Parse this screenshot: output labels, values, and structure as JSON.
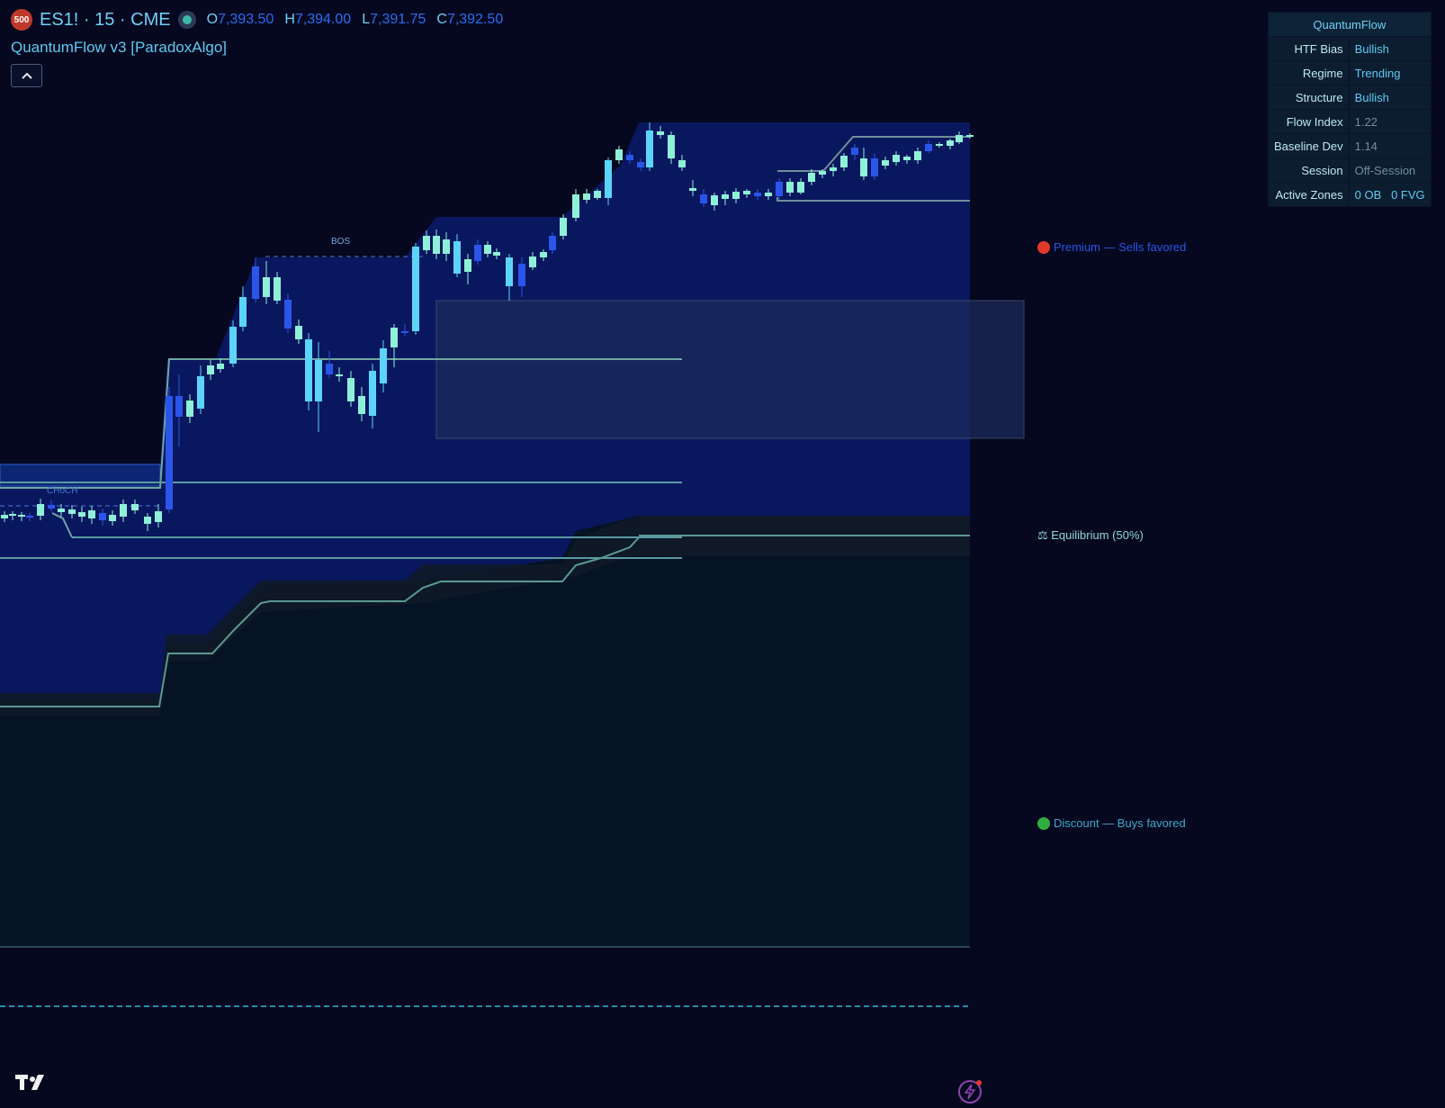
{
  "header": {
    "badge": "500",
    "symbol": "ES1! · 15 · CME",
    "ohlc": [
      {
        "key": "O",
        "value": "7,393.50"
      },
      {
        "key": "H",
        "value": "7,394.00"
      },
      {
        "key": "L",
        "value": "7,391.75"
      },
      {
        "key": "C",
        "value": "7,392.50"
      }
    ]
  },
  "indicator": {
    "title": "QuantumFlow v3 [ParadoxAlgo]"
  },
  "panel": {
    "title": "QuantumFlow",
    "rows": [
      {
        "label": "HTF Bias",
        "value": "Bullish",
        "color": "#5ecbf2"
      },
      {
        "label": "Regime",
        "value": "Trending",
        "color": "#5ecbf2"
      },
      {
        "label": "Structure",
        "value": "Bullish",
        "color": "#5ecbf2"
      },
      {
        "label": "Flow Index",
        "value": "1.22",
        "color": "#6f8fa0"
      },
      {
        "label": "Baseline Dev",
        "value": "1.14",
        "color": "#6f8fa0"
      },
      {
        "label": "Session",
        "value": "Off-Session",
        "color": "#6f8fa0"
      },
      {
        "label": "Active Zones",
        "value": "0 OB   0 FVG",
        "color": "#5ecbf2"
      }
    ]
  },
  "zones": {
    "premium": "Premium — Sells favored",
    "equilibrium": "⚖ Equilibrium (50%)",
    "discount": "Discount — Buys favored"
  },
  "annotations": {
    "bos": "BOS",
    "choch": "CHoCH"
  },
  "colors": {
    "bull": "#8ff0d8",
    "bull_strong": "#5cd4f8",
    "bear": "#2a55e8",
    "premium_dot": "#e0392b",
    "discount_dot": "#2fae3f",
    "premium_text": "#2a55e8",
    "discount_text": "#3fa8c8"
  }
}
